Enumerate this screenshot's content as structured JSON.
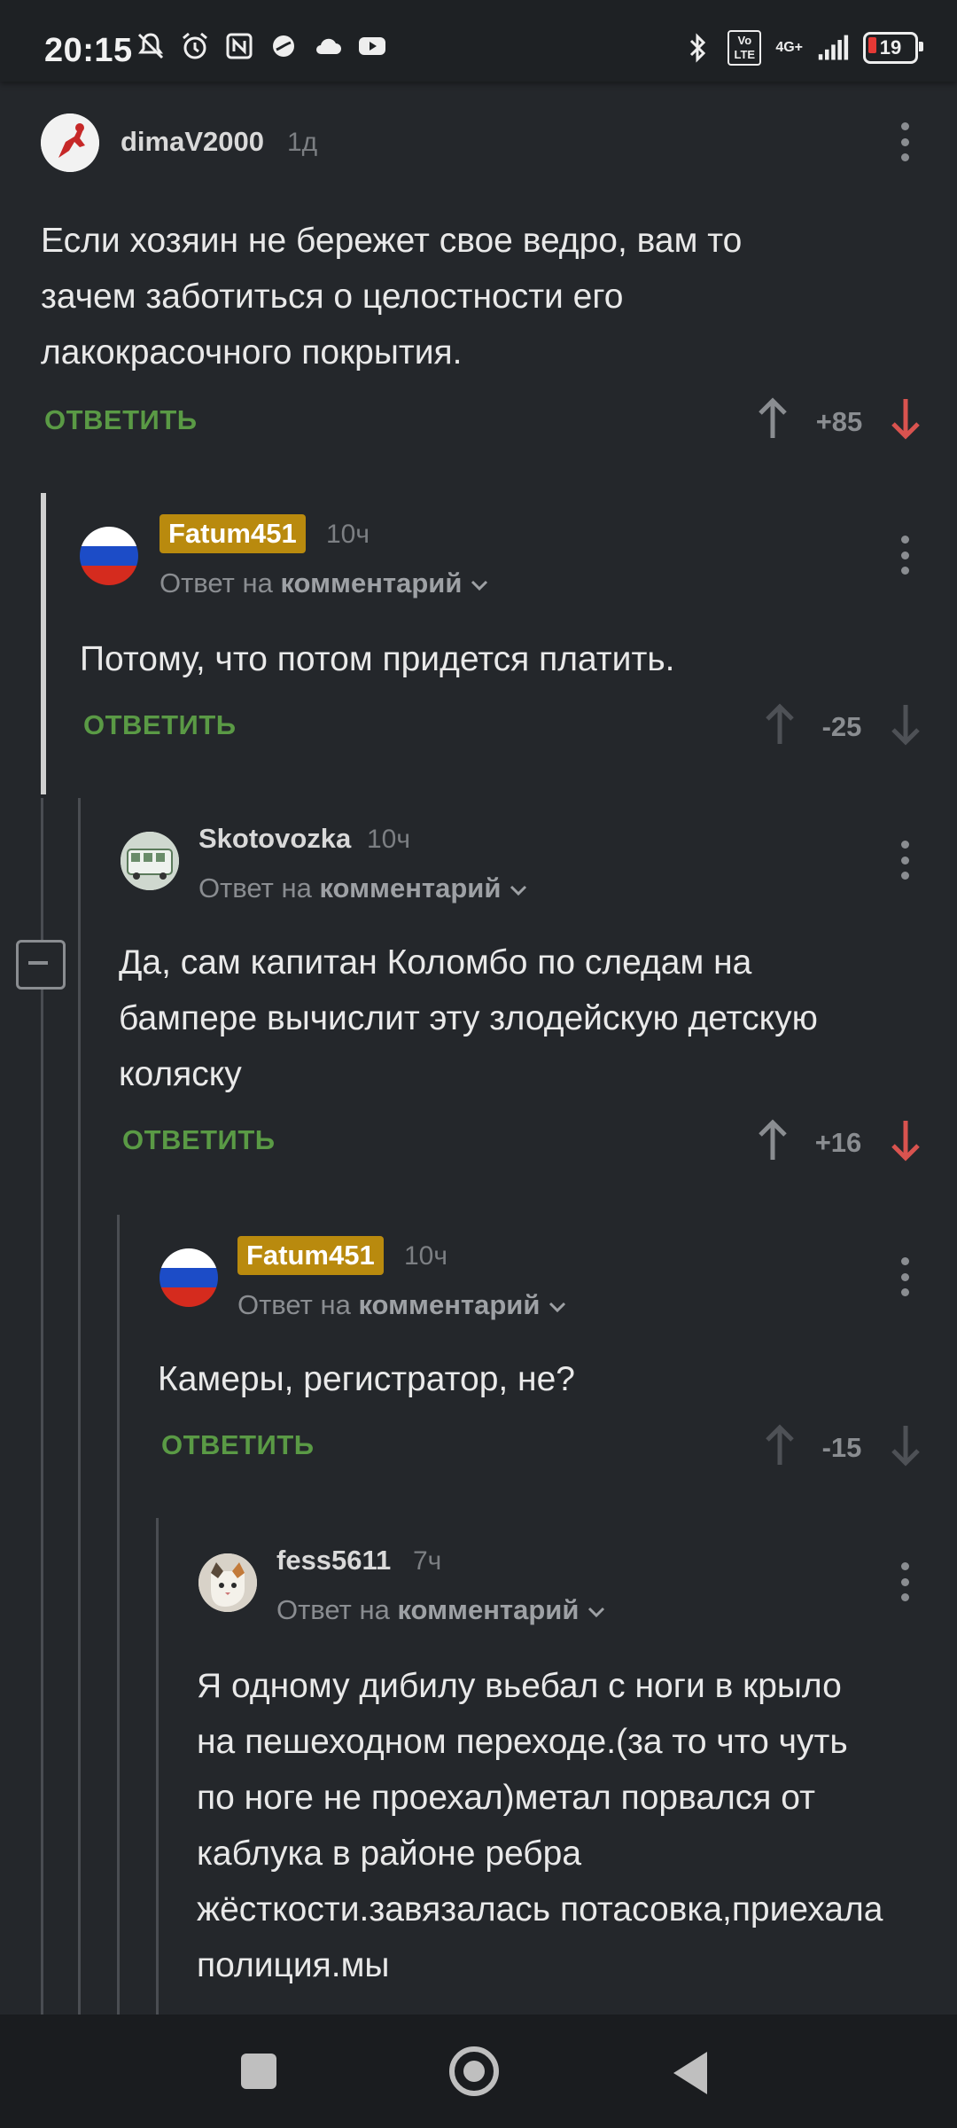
{
  "status": {
    "time": "20:15",
    "network": "4G+",
    "volte": "Vo LTE",
    "battery": "19"
  },
  "labels": {
    "reply_to": "Ответ на",
    "comment": "комментарий",
    "answer": "ОТВЕТИТЬ"
  },
  "colors": {
    "background": "#24272b",
    "answer_green": "#5a9a45",
    "downvote_red": "#d9534f",
    "badge_gold": "#b98a0e"
  },
  "comments": [
    {
      "user": "dimaV2000",
      "time": "1д",
      "text": "Если хозяин не бережет свое ведро, вам то зачем заботиться о целостности его лакокрасочного покрытия.",
      "score": "+85",
      "avatar": "cartoon-avatar"
    },
    {
      "user": "Fatum451",
      "time": "10ч",
      "text": "Потому, что потом придется платить.",
      "score": "-25",
      "avatar": "russian-flag-avatar"
    },
    {
      "user": "Skotovozka",
      "time": "10ч",
      "text": "Да, сам капитан Коломбо по следам на бампере вычислит эту злодейскую детскую коляску",
      "score": "+16",
      "avatar": "bus-avatar"
    },
    {
      "user": "Fatum451",
      "time": "10ч",
      "text": "Камеры, регистратор, не?",
      "score": "-15",
      "avatar": "russian-flag-avatar"
    },
    {
      "user": "fess5611",
      "time": "7ч",
      "text": "Я одному дибилу вьебал с ноги в крыло на пешеходном переходе.(за то что чуть по ноге не проехал)метал порвался от каблука в районе ребра жёсткости.завязалась потасовка,приехала полиция.мы",
      "avatar": "cat-avatar"
    }
  ]
}
